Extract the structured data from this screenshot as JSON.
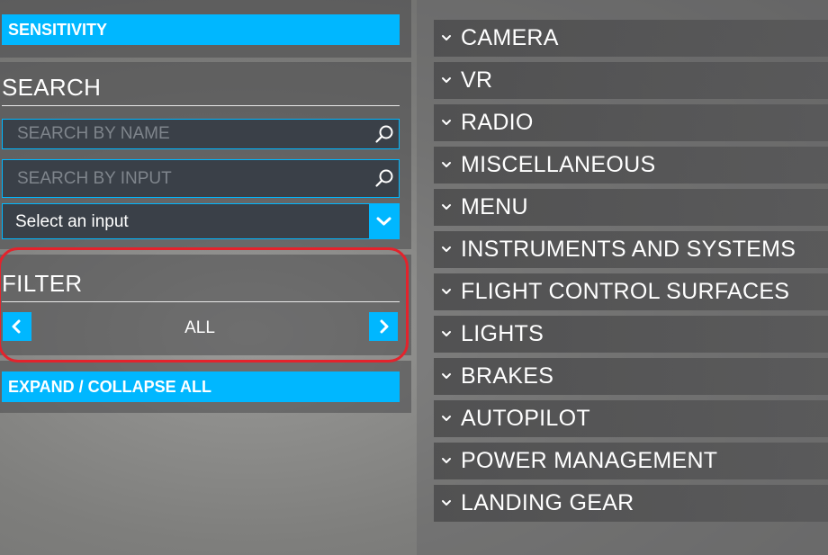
{
  "left": {
    "sensitivity_button": "SENSITIVITY",
    "search": {
      "title": "SEARCH",
      "by_name_placeholder": "SEARCH BY NAME",
      "by_input_placeholder": "SEARCH BY INPUT",
      "select_input_label": "Select an input"
    },
    "filter": {
      "title": "FILTER",
      "value": "ALL"
    },
    "expand_collapse_button": "EXPAND / COLLAPSE ALL"
  },
  "categories": [
    "CAMERA",
    "VR",
    "RADIO",
    "MISCELLANEOUS",
    "MENU",
    "INSTRUMENTS AND SYSTEMS",
    "FLIGHT CONTROL SURFACES",
    "LIGHTS",
    "BRAKES",
    "AUTOPILOT",
    "POWER MANAGEMENT",
    "LANDING GEAR"
  ],
  "colors": {
    "accent": "#00b7ff",
    "highlight_outline": "#e3232c",
    "field_bg": "#3a4048"
  },
  "icons": {
    "search": "magnifier-icon",
    "dropdown": "chevron-down-icon",
    "prev": "chevron-left-icon",
    "next": "chevron-right-icon",
    "category": "chevron-down-icon"
  }
}
